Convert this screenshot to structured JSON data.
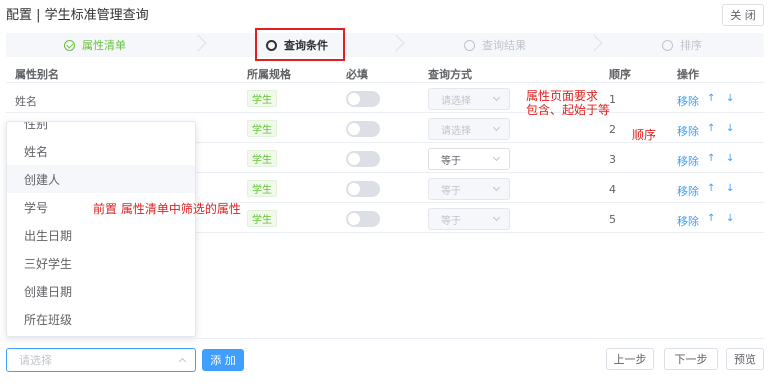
{
  "title": "配置 | 学生标准管理查询",
  "close_label": "关 闭",
  "steps": [
    {
      "label": "属性清单",
      "state": "done"
    },
    {
      "label": "查询条件",
      "state": "active"
    },
    {
      "label": "查询结果",
      "state": "pending"
    },
    {
      "label": "排序",
      "state": "pending"
    }
  ],
  "table": {
    "headers": [
      "属性别名",
      "所属规格",
      "必填",
      "查询方式",
      "顺序",
      "操作"
    ],
    "rows": [
      {
        "alias": "姓名",
        "spec": "学生",
        "query": "请选择",
        "order": "1"
      },
      {
        "alias": "",
        "spec": "学生",
        "query": "请选择",
        "order": "2"
      },
      {
        "alias": "",
        "spec": "学生",
        "query": "等于",
        "order": "3"
      },
      {
        "alias": "",
        "spec": "学生",
        "query": "等于",
        "order": "4"
      },
      {
        "alias": "",
        "spec": "学生",
        "query": "等于",
        "order": "5"
      }
    ],
    "remove_label": "移除",
    "up_glyph": "↑",
    "down_glyph": "↓"
  },
  "annotations": {
    "query_rule_line1": "属性页面要求",
    "query_rule_line2": "包含、起始于等",
    "order_note": "顺序",
    "prefilter_note": "前置 属性清单中筛选的属性"
  },
  "dropdown": {
    "cut_label": "性别",
    "options": [
      "姓名",
      "创建人",
      "学号",
      "出生日期",
      "三好学生",
      "创建日期",
      "所在班级"
    ],
    "hovered": "创建人"
  },
  "bottom": {
    "select_placeholder": "请选择",
    "add_label": "添 加",
    "prev_label": "上一步",
    "next_label": "下一步",
    "preview_label": "预览"
  },
  "colors": {
    "accent": "#409eff",
    "success": "#67c23a",
    "annotation": "#e02020"
  }
}
